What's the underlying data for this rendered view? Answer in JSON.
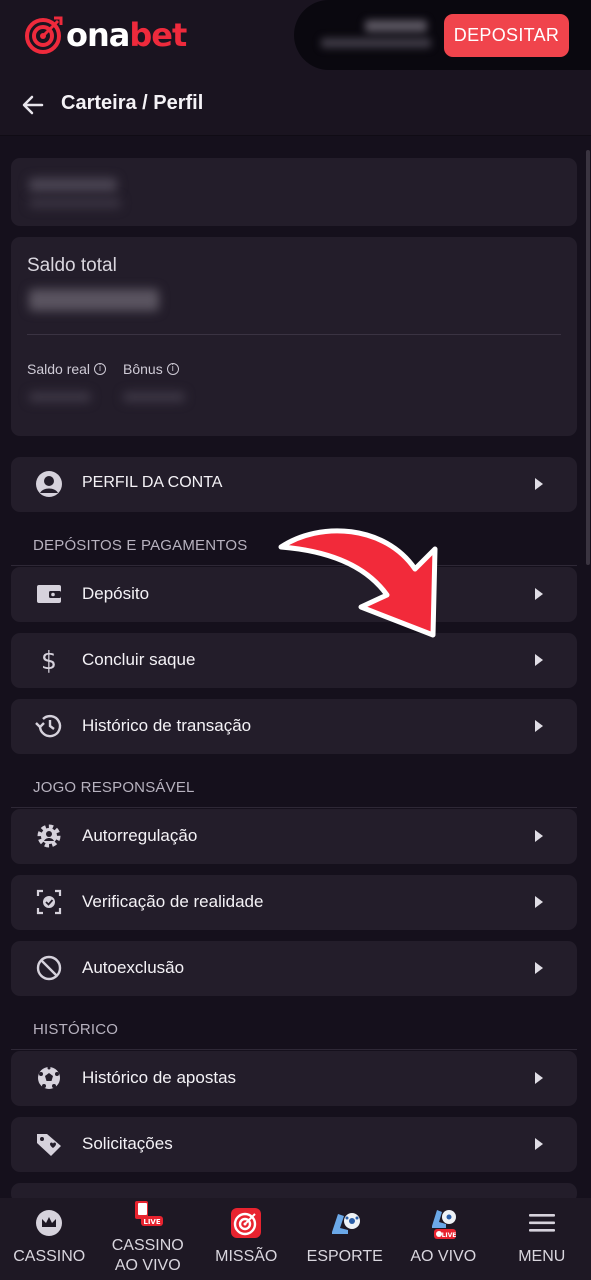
{
  "header": {
    "logo_text_a": "ona",
    "logo_text_b": "bet",
    "deposit_label": "DEPOSITAR"
  },
  "subheader": {
    "title": "Carteira / Perfil"
  },
  "balance": {
    "total_label": "Saldo total",
    "real_label": "Saldo real",
    "bonus_label": "Bônus"
  },
  "profile_row": {
    "label": "PERFIL DA CONTA"
  },
  "sections": {
    "payments": "DEPÓSITOS E PAGAMENTOS",
    "responsible": "JOGO RESPONSÁVEL",
    "history": "HISTÓRICO"
  },
  "payments_items": [
    {
      "label": "Depósito",
      "icon": "wallet-icon"
    },
    {
      "label": "Concluir saque",
      "icon": "dollar-icon"
    },
    {
      "label": "Histórico de transação",
      "icon": "history-icon"
    }
  ],
  "responsible_items": [
    {
      "label": "Autorregulação",
      "icon": "gear-face-icon"
    },
    {
      "label": "Verificação de realidade",
      "icon": "reality-check-icon"
    },
    {
      "label": "Autoexclusão",
      "icon": "block-icon"
    }
  ],
  "history_items": [
    {
      "label": "Histórico de apostas",
      "icon": "ball-icon"
    },
    {
      "label": "Solicitações",
      "icon": "tag-heart-icon"
    }
  ],
  "bottom_nav": [
    {
      "label": "CASSINO",
      "icon": "crown-icon"
    },
    {
      "label": "CASSINO\nAO VIVO",
      "line1": "CASSINO",
      "line2": "AO VIVO",
      "icon": "live-casino-icon"
    },
    {
      "label": "MISSÃO",
      "icon": "target-icon"
    },
    {
      "label": "ESPORTE",
      "icon": "sport-shoe-icon"
    },
    {
      "label": "AO VIVO",
      "icon": "live-sport-icon"
    },
    {
      "label": "MENU",
      "icon": "hamburger-icon"
    }
  ],
  "colors": {
    "accent": "#f0444c",
    "brand_red": "#ee2a3c",
    "background": "#15101c",
    "card": "#231d2a"
  }
}
